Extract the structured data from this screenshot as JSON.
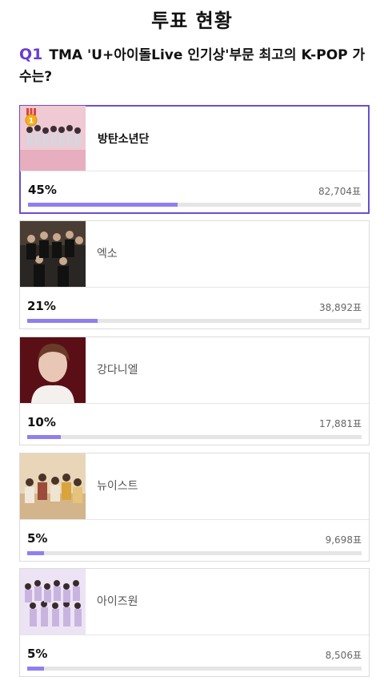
{
  "page": {
    "title": "투표 현황"
  },
  "question": {
    "number": "Q1",
    "text": "TMA 'U+아이돌Live 인기상'부문 최고의 K-POP 가수는?"
  },
  "colors": {
    "accent": "#6a3bd2",
    "bar_fill": "#8f7ff0",
    "selected_border": "#6a4fd0"
  },
  "candidates": [
    {
      "name": "방탄소년단",
      "percent": "45%",
      "votes": "82,704표",
      "fill": 0.45,
      "selected": true,
      "badge": "1",
      "badge_icon": "gold-medal-icon"
    },
    {
      "name": "엑소",
      "percent": "21%",
      "votes": "38,892표",
      "fill": 0.21,
      "selected": false
    },
    {
      "name": "강다니엘",
      "percent": "10%",
      "votes": "17,881표",
      "fill": 0.1,
      "selected": false
    },
    {
      "name": "뉴이스트",
      "percent": "5%",
      "votes": "9,698표",
      "fill": 0.05,
      "selected": false
    },
    {
      "name": "아이즈원",
      "percent": "5%",
      "votes": "8,506표",
      "fill": 0.05,
      "selected": false
    }
  ]
}
